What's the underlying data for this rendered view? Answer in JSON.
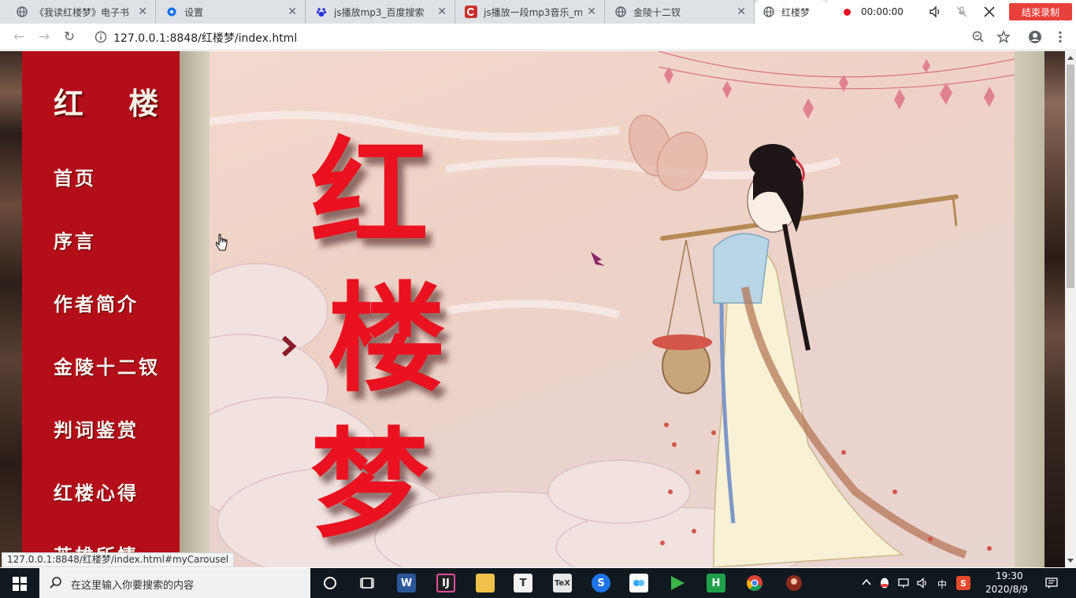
{
  "browser": {
    "tabs": [
      {
        "label": "《我读红楼梦》电子书",
        "icon": "globe-icon",
        "active": false
      },
      {
        "label": "设置",
        "icon": "gear-icon",
        "active": false
      },
      {
        "label": "js播放mp3_百度搜索",
        "icon": "baidu-paw-icon",
        "active": false
      },
      {
        "label": "js播放一段mp3音乐_m",
        "icon": "csdn-icon",
        "active": false
      },
      {
        "label": "金陵十二钗",
        "icon": "globe-icon",
        "active": false
      },
      {
        "label": "红楼梦",
        "icon": "globe-icon",
        "active": true
      }
    ],
    "recorder": {
      "time": "00:00:00",
      "end_label": "结束录制"
    },
    "url": "127.0.0.1:8848/红楼梦/index.html"
  },
  "page": {
    "brand": "红 楼",
    "menu": [
      "首页",
      "序言",
      "作者简介",
      "金陵十二钗",
      "判词鉴赏",
      "红楼心得",
      "英雄所情"
    ],
    "hero_title_chars": [
      "红",
      "楼",
      "梦"
    ],
    "carousel_prev_icon": "chevron-left-icon"
  },
  "status_bar": "127.0.0.1:8848/红楼梦/index.html#myCarousel",
  "taskbar": {
    "search_placeholder": "在这里输入你要搜索的内容",
    "tray_ime": "中",
    "clock_time": "19:30",
    "clock_date": "2020/8/9"
  },
  "colors": {
    "sidebar": "#b50e1b",
    "title_red": "#ea1220",
    "poster_bg": "#efd2c6",
    "recorder_end": "#e8403a"
  }
}
